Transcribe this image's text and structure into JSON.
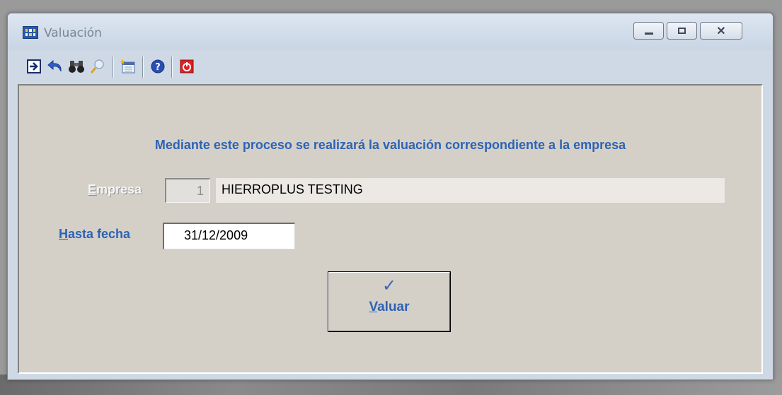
{
  "window": {
    "title": "Valuación",
    "controls": {
      "minimize": "▭",
      "maximize": "◻",
      "close": "✕"
    }
  },
  "toolbar": {
    "items": [
      {
        "name": "exit-icon"
      },
      {
        "name": "undo-icon"
      },
      {
        "name": "binoculars-icon"
      },
      {
        "name": "magnifier-icon"
      },
      {
        "name": "new-document-icon"
      },
      {
        "name": "help-icon"
      },
      {
        "name": "power-icon"
      }
    ]
  },
  "form": {
    "message": "Mediante este proceso se realizará la valuación correspondiente a la empresa",
    "empresa": {
      "label_first": "E",
      "label_rest": "mpresa",
      "code": "1",
      "name": "HIERROPLUS TESTING"
    },
    "hasta_fecha": {
      "label_first": "H",
      "label_rest": "asta fecha",
      "value": "31/12/2009"
    },
    "valuar_button": {
      "icon": "✓",
      "label_first": "V",
      "label_rest": "aluar"
    }
  },
  "colors": {
    "accent_text": "#2d63b5",
    "client_bg": "#d4d0c8",
    "disabled_label": "#f5f5f5"
  }
}
